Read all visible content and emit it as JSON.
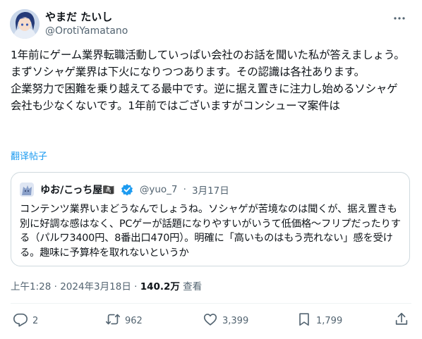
{
  "colors": {
    "accent": "#1d9bf0",
    "text": "#0f1419",
    "muted": "#536471",
    "border": "#cfd9de"
  },
  "author": {
    "display_name": "やまだ たいし",
    "handle": "@OrotiYamatano"
  },
  "tweet": {
    "text": "1年前にゲーム業界転職活動していっぱい会社のお話を聞いた私が答えましょう。\nまずソシャゲ業界は下火になりつつあります。その認識は各社あります。\n企業努力で困難を乗り越えてる最中です。逆に据え置きに注力し始めるソシャゲ会社も少なくないです。1年前ではございますがコンシューマ案件は",
    "translate_label": "翻译帖子"
  },
  "quoted_tweet": {
    "display_name": "ゆお/こっち屋🏴‍☠️",
    "handle": "@yuo_7",
    "separator": "·",
    "date": "3月17日",
    "text": "コンテンツ業界いまどうなんでしょうね。ソシャゲが苦境なのは聞くが、据え置きも別に好調な感はなく、PCゲーが話題になりやすいがいうて低価格〜フリプだったりする（パルワ3400円、8番出口470円）。明確に「高いものはもう売れない」感を受ける。趣味に予算枠を取れないというか"
  },
  "meta": {
    "timestamp": "上午1:28 · 2024年3月18日 · ",
    "views_count": "140.2万",
    "views_label": " 查看"
  },
  "actions": {
    "replies": "2",
    "reposts": "962",
    "likes": "3,399",
    "bookmarks": "1,799"
  },
  "icons": [
    "avatar",
    "more-icon",
    "verified-badge-icon",
    "reply-icon",
    "repost-icon",
    "like-icon",
    "bookmark-icon",
    "share-icon"
  ]
}
